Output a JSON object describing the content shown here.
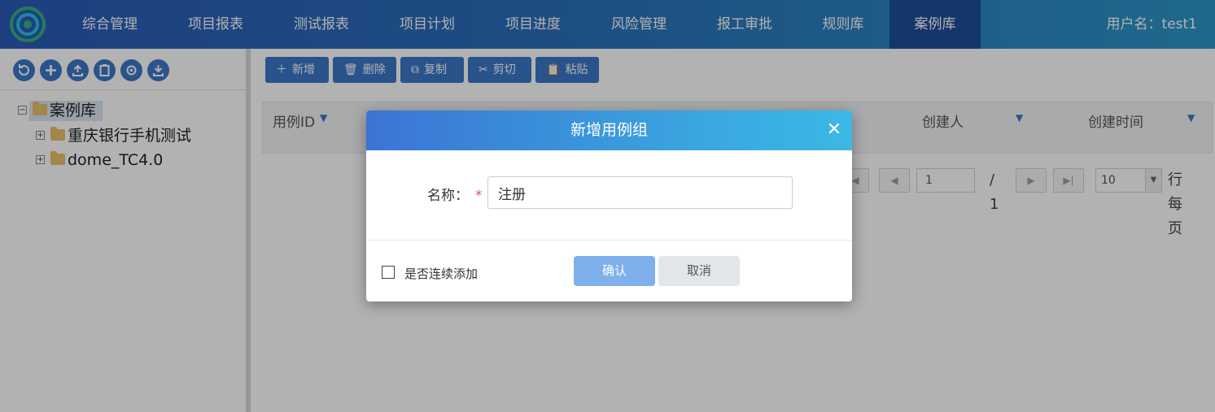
{
  "nav": {
    "items": [
      {
        "label": "综合管理"
      },
      {
        "label": "项目报表"
      },
      {
        "label": "测试报表"
      },
      {
        "label": "项目计划"
      },
      {
        "label": "项目进度"
      },
      {
        "label": "风险管理"
      },
      {
        "label": "报工审批"
      },
      {
        "label": "规则库"
      },
      {
        "label": "案例库"
      }
    ],
    "active": "案例库",
    "user": "用户名：test1"
  },
  "sidebar": {
    "tools": [
      "refresh-icon",
      "add-icon",
      "upload-icon",
      "clipboard-icon",
      "settings-icon",
      "download-icon"
    ],
    "tree": {
      "root": "案例库",
      "children": [
        {
          "label": "重庆银行手机测试"
        },
        {
          "label": "dome_TC4.0"
        }
      ]
    }
  },
  "toolbar": {
    "add": "新增",
    "delete": "删除",
    "copy": "复制",
    "cut": "剪切",
    "paste": "粘贴"
  },
  "grid": {
    "columns": [
      "用例ID",
      "创建人",
      "创建时间"
    ]
  },
  "pager": {
    "page": "1",
    "total": "/ 1",
    "page_size": "10",
    "per_page_label": "行每页"
  },
  "dialog": {
    "title": "新增用例组",
    "name_label": "名称：",
    "required_mark": "*",
    "name_value": "注册",
    "continue_label": "是否连续添加",
    "ok": "确认",
    "cancel": "取消"
  },
  "colors": {
    "accent": "#3c78c8",
    "nav_active": "#1d4e9a",
    "required": "#d9534f"
  }
}
